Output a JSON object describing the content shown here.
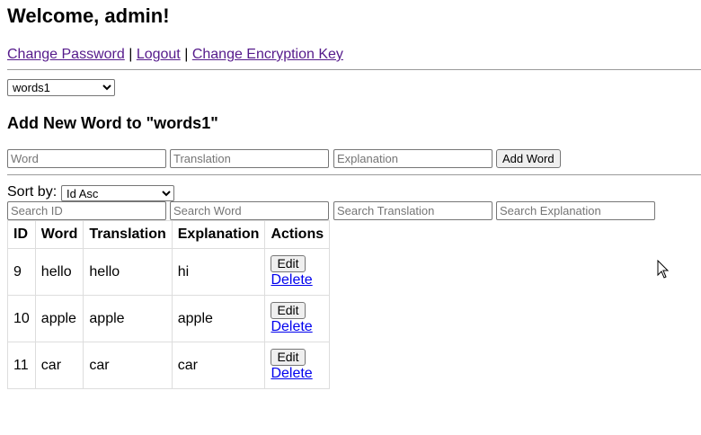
{
  "header": {
    "welcome": "Welcome, admin!"
  },
  "nav": {
    "change_password": "Change Password",
    "logout": "Logout",
    "change_encryption_key": "Change Encryption Key",
    "separator": "|"
  },
  "list_select": {
    "selected": "words1"
  },
  "add_form": {
    "heading": "Add New Word to \"words1\"",
    "word_placeholder": "Word",
    "translation_placeholder": "Translation",
    "explanation_placeholder": "Explanation",
    "button": "Add Word"
  },
  "sort": {
    "label": "Sort by:",
    "selected": "Id Asc"
  },
  "search": {
    "id_placeholder": "Search ID",
    "word_placeholder": "Search Word",
    "translation_placeholder": "Search Translation",
    "explanation_placeholder": "Search Explanation"
  },
  "table": {
    "columns": [
      "ID",
      "Word",
      "Translation",
      "Explanation",
      "Actions"
    ],
    "rows": [
      {
        "id": "9",
        "word": "hello",
        "translation": "hello",
        "explanation": "hi",
        "edit": "Edit",
        "delete": "Delete"
      },
      {
        "id": "10",
        "word": "apple",
        "translation": "apple",
        "explanation": "apple",
        "edit": "Edit",
        "delete": "Delete"
      },
      {
        "id": "11",
        "word": "car",
        "translation": "car",
        "explanation": "car",
        "edit": "Edit",
        "delete": "Delete"
      }
    ]
  }
}
